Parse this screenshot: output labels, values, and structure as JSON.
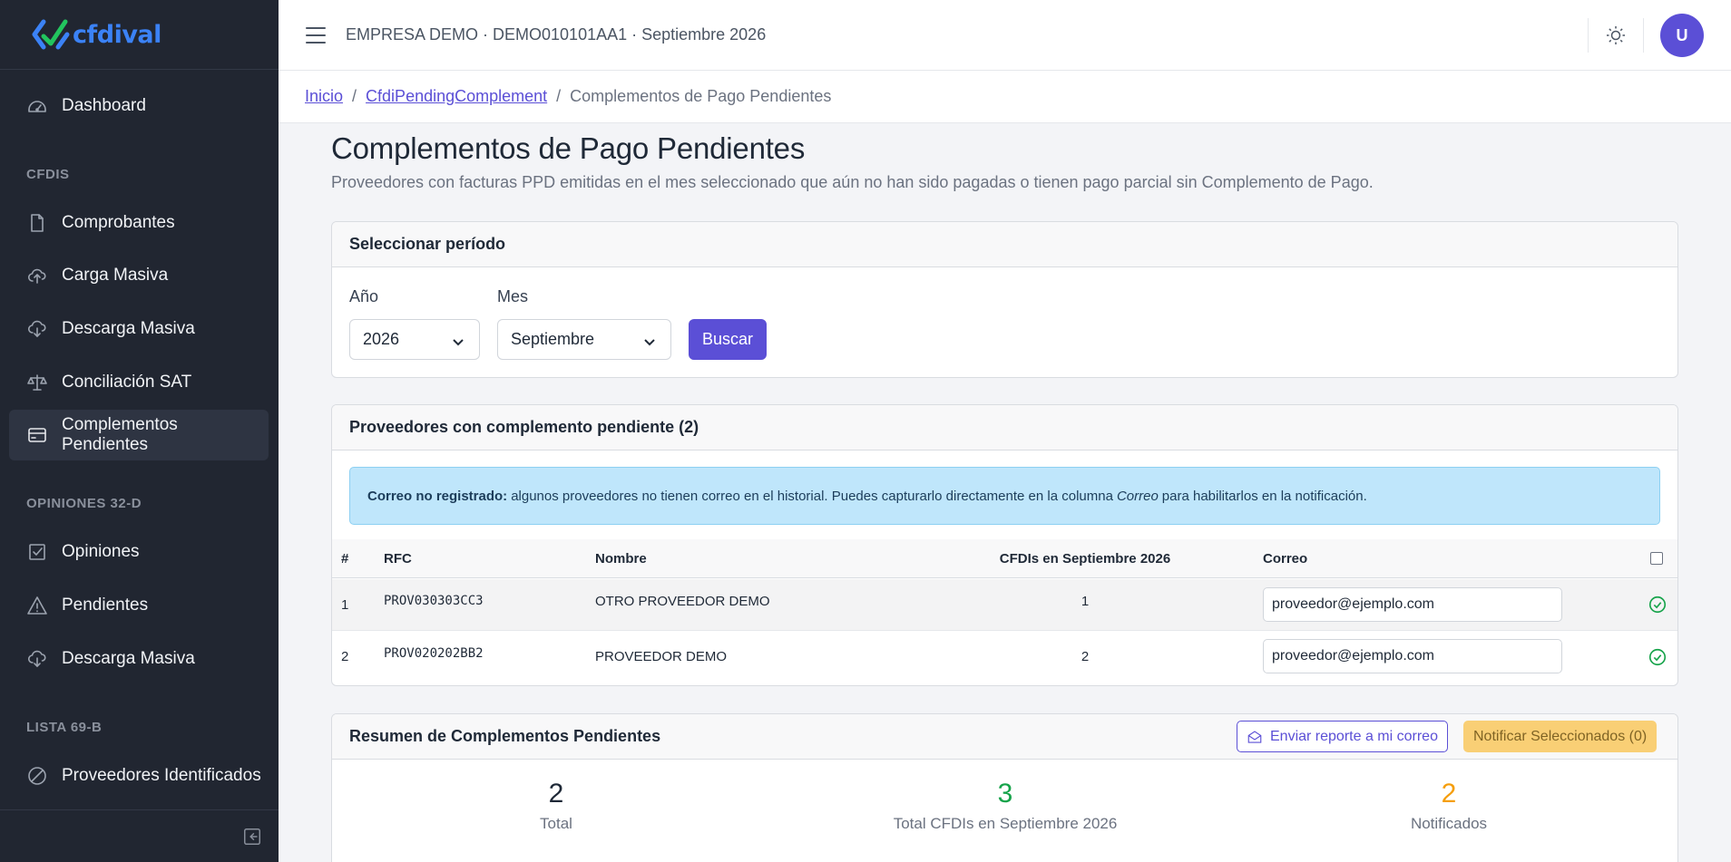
{
  "brand": {
    "name": "cfdival",
    "accent": "#3b82f6"
  },
  "sidebar": {
    "items": [
      {
        "label": "Dashboard",
        "icon": "speedometer-icon"
      },
      {
        "label": "Comprobantes",
        "icon": "file-icon"
      },
      {
        "label": "Carga Masiva",
        "icon": "cloud-upload-icon"
      },
      {
        "label": "Descarga Masiva",
        "icon": "cloud-download-icon"
      },
      {
        "label": "Conciliación SAT",
        "icon": "scale-icon"
      },
      {
        "label": "Complementos Pendientes",
        "icon": "credit-card-icon",
        "active": true
      },
      {
        "label": "Opiniones",
        "icon": "check-square-icon"
      },
      {
        "label": "Pendientes",
        "icon": "warning-icon"
      },
      {
        "label": "Descarga Masiva",
        "icon": "cloud-download-icon"
      },
      {
        "label": "Proveedores Identificados",
        "icon": "ban-icon"
      }
    ],
    "sections": [
      "CFDIS",
      "OPINIONES 32-D",
      "LISTA 69-B"
    ]
  },
  "header": {
    "title": "EMPRESA DEMO · DEMO010101AA1 · Septiembre 2026",
    "avatar_initial": "U"
  },
  "breadcrumb": {
    "home": "Inicio",
    "parent": "CfdiPendingComplement",
    "current": "Complementos de Pago Pendientes",
    "separator": "/"
  },
  "page": {
    "title": "Complementos de Pago Pendientes",
    "subtitle": "Proveedores con facturas PPD emitidas en el mes seleccionado que aún no han sido pagadas o tienen pago parcial sin Complemento de Pago."
  },
  "period_card": {
    "title": "Seleccionar período",
    "year_label": "Año",
    "year_value": "2026",
    "month_label": "Mes",
    "month_value": "Septiembre",
    "search_button": "Buscar"
  },
  "providers_card": {
    "title": "Proveedores con complemento pendiente (2)",
    "alert_bold": "Correo no registrado:",
    "alert_text": "algunos proveedores no tienen correo en el historial. Puedes capturarlo directamente en la columna",
    "alert_italic": "Correo",
    "alert_tail": "para habilitarlos en la notificación.",
    "columns": [
      "#",
      "RFC",
      "Nombre",
      "CFDIs en Septiembre 2026",
      "Correo"
    ],
    "rows": [
      {
        "num": "1",
        "rfc": "PROV030303CC3",
        "name": "OTRO PROVEEDOR DEMO",
        "cfdis": "1",
        "email": "proveedor@ejemplo.com"
      },
      {
        "num": "2",
        "rfc": "PROV020202BB2",
        "name": "PROVEEDOR DEMO",
        "cfdis": "2",
        "email": "proveedor@ejemplo.com"
      }
    ]
  },
  "summary_card": {
    "title": "Resumen de Complementos Pendientes",
    "send_button": "Enviar reporte a mi correo",
    "notify_button": "Notificar Seleccionados (0)",
    "stats": [
      {
        "value": "2",
        "label": "Total",
        "color": "#1f2937"
      },
      {
        "value": "3",
        "label": "Total CFDIs en Septiembre 2026",
        "color": "#16a34a"
      },
      {
        "value": "2",
        "label": "Notificados",
        "color": "#f59e0b"
      }
    ]
  },
  "colors": {
    "primary": "#5b4fd6",
    "sidebar_bg": "#212631",
    "warning": "#fac95e",
    "success": "#16a34a"
  }
}
